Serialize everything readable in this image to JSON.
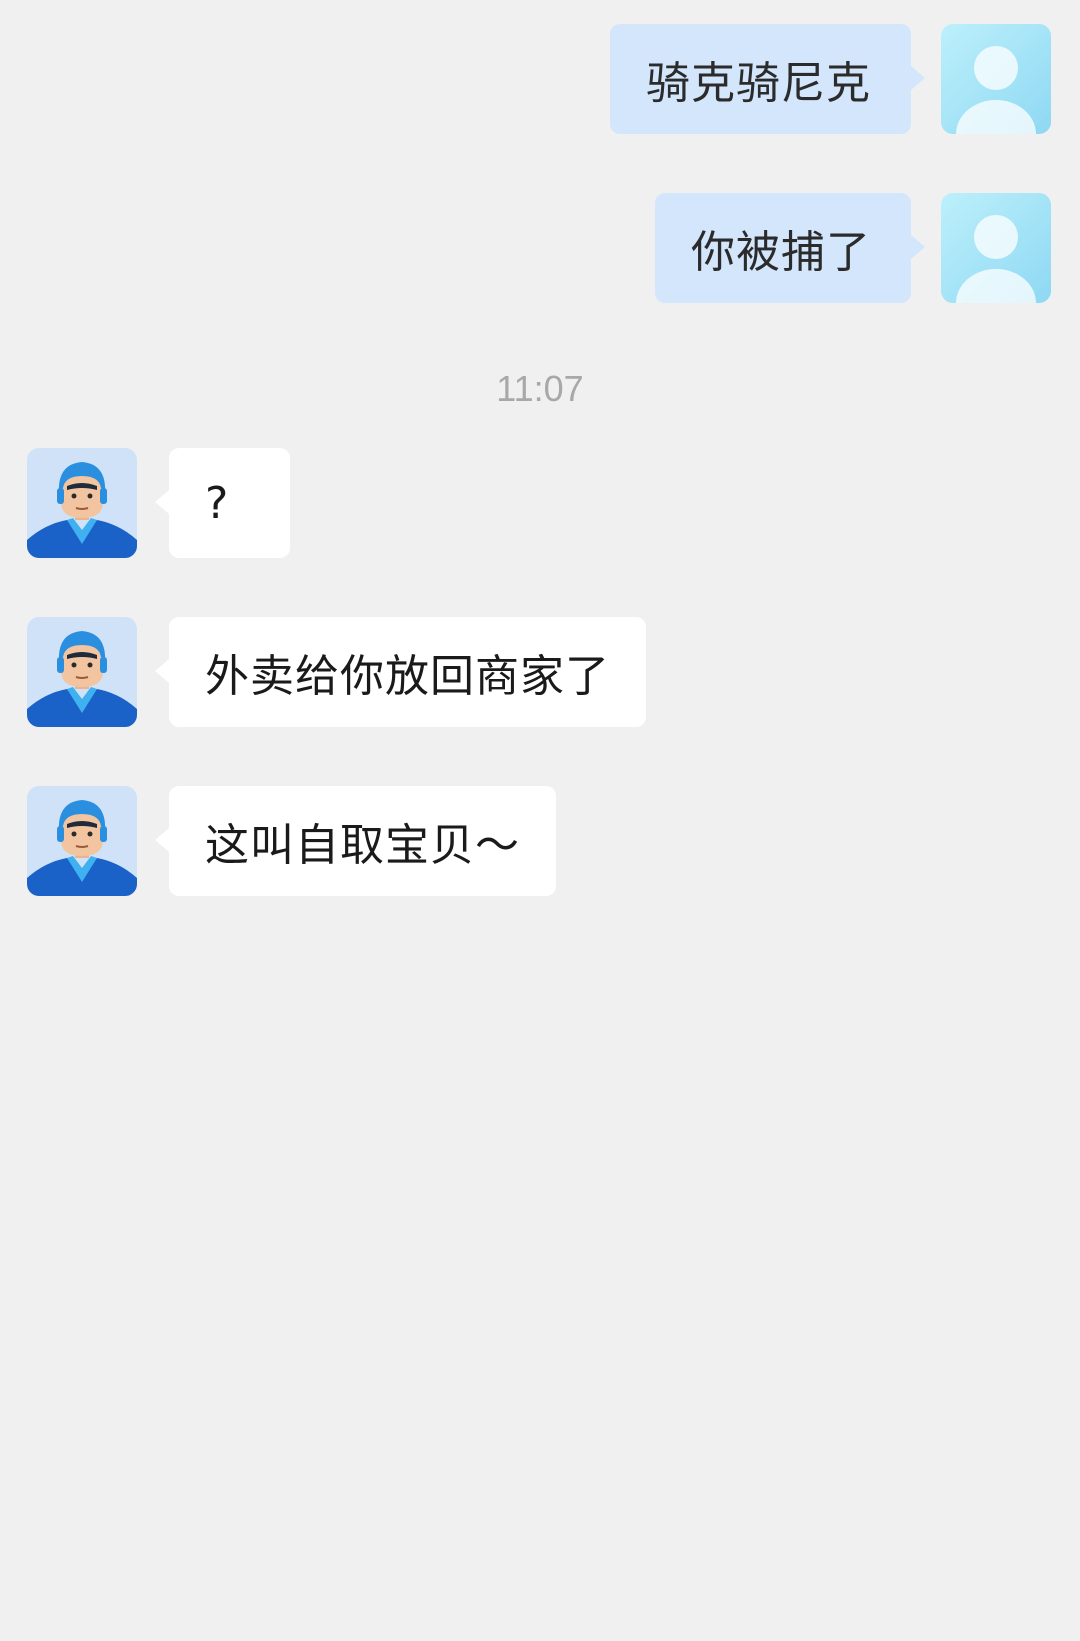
{
  "timestamp": "11:07",
  "messages": [
    {
      "side": "out",
      "text": "骑克骑尼克",
      "avatar": "default-user-avatar"
    },
    {
      "side": "out",
      "text": "你被捕了",
      "avatar": "default-user-avatar"
    },
    {
      "side": "in",
      "text": "?",
      "avatar": "delivery-rider-avatar"
    },
    {
      "side": "in",
      "text": "外卖给你放回商家了",
      "avatar": "delivery-rider-avatar"
    },
    {
      "side": "in",
      "text": "这叫自取宝贝～",
      "avatar": "delivery-rider-avatar"
    }
  ],
  "colors": {
    "background": "#f0f0f0",
    "outgoing_bubble": "#d4e6fc",
    "incoming_bubble": "#ffffff",
    "timestamp_text": "#a8a8a8"
  }
}
